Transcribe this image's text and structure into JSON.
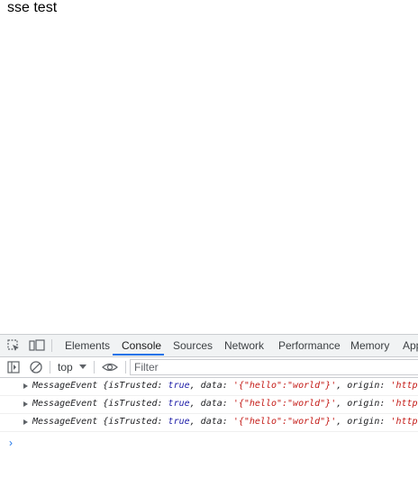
{
  "page": {
    "text": "sse test"
  },
  "devtools": {
    "tabs": [
      "Elements",
      "Console",
      "Sources",
      "Network",
      "Performance",
      "Memory",
      "App"
    ],
    "active_tab": "Console",
    "context": "top",
    "filter_placeholder": "Filter",
    "log_entries": [
      {
        "type": "MessageEvent",
        "open": " {",
        "k1": "isTrusted:",
        "v1": "true",
        "k2": ", data:",
        "v2": "'{\"hello\":\"world\"}'",
        "k3": ", origin:",
        "v3": "'http://"
      },
      {
        "type": "MessageEvent",
        "open": " {",
        "k1": "isTrusted:",
        "v1": "true",
        "k2": ", data:",
        "v2": "'{\"hello\":\"world\"}'",
        "k3": ", origin:",
        "v3": "'http://"
      },
      {
        "type": "MessageEvent",
        "open": " {",
        "k1": "isTrusted:",
        "v1": "true",
        "k2": ", data:",
        "v2": "'{\"hello\":\"world\"}'",
        "k3": ", origin:",
        "v3": "'http://"
      }
    ],
    "prompt": "›",
    "colors": {
      "accent": "#1a73e8",
      "keyword": "#1a1aa6",
      "string": "#c41a16"
    }
  }
}
